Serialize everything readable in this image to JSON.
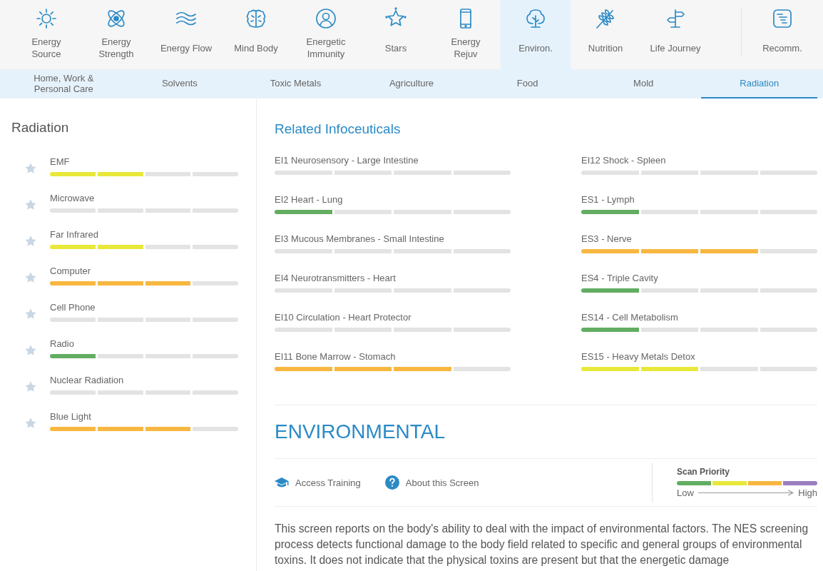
{
  "nav": [
    {
      "label": "Energy Source",
      "kind": "sun",
      "selected": false
    },
    {
      "label": "Energy Strength",
      "kind": "atom",
      "selected": false
    },
    {
      "label": "Energy Flow",
      "kind": "waves",
      "selected": false
    },
    {
      "label": "Mind Body",
      "kind": "brain",
      "selected": false
    },
    {
      "label": "Energetic Immunity",
      "kind": "person",
      "selected": false
    },
    {
      "label": "Stars",
      "kind": "star",
      "selected": false
    },
    {
      "label": "Energy Rejuv",
      "kind": "phone",
      "selected": false
    },
    {
      "label": "Environ.",
      "kind": "tree",
      "selected": true
    },
    {
      "label": "Nutrition",
      "kind": "wheat",
      "selected": false
    },
    {
      "label": "Life Journey",
      "kind": "signpost",
      "selected": false
    },
    {
      "label": "Recomm.",
      "kind": "list",
      "selected": false
    }
  ],
  "subtabs": [
    {
      "label": "Home, Work & Personal Care",
      "selected": false
    },
    {
      "label": "Solvents",
      "selected": false
    },
    {
      "label": "Toxic Metals",
      "selected": false
    },
    {
      "label": "Agriculture",
      "selected": false
    },
    {
      "label": "Food",
      "selected": false
    },
    {
      "label": "Mold",
      "selected": false
    },
    {
      "label": "Radiation",
      "selected": true
    }
  ],
  "factors": {
    "title": "Radiation",
    "items": [
      {
        "name": "EMF",
        "color": "#e8e83a",
        "segments": [
          {
            "filled": true
          },
          {
            "filled": true
          },
          {
            "filled": false
          },
          {
            "filled": false
          }
        ]
      },
      {
        "name": "Microwave",
        "segments": [
          {
            "filled": false
          },
          {
            "filled": false
          },
          {
            "filled": false
          },
          {
            "filled": false
          }
        ]
      },
      {
        "name": "Far Infrared",
        "color": "#e8e83a",
        "segments": [
          {
            "filled": true
          },
          {
            "filled": true
          },
          {
            "filled": false
          },
          {
            "filled": false
          }
        ]
      },
      {
        "name": "Computer",
        "color": "#f7b740",
        "segments": [
          {
            "filled": true
          },
          {
            "filled": true
          },
          {
            "filled": true
          },
          {
            "filled": false
          }
        ]
      },
      {
        "name": "Cell Phone",
        "segments": [
          {
            "filled": false
          },
          {
            "filled": false
          },
          {
            "filled": false
          },
          {
            "filled": false
          }
        ]
      },
      {
        "name": "Radio",
        "color": "#62ad62",
        "segments": [
          {
            "filled": true
          },
          {
            "filled": false
          },
          {
            "filled": false
          },
          {
            "filled": false
          }
        ]
      },
      {
        "name": "Nuclear Radiation",
        "segments": [
          {
            "filled": false
          },
          {
            "filled": false
          },
          {
            "filled": false
          },
          {
            "filled": false
          }
        ]
      },
      {
        "name": "Blue Light",
        "color": "#f7b740",
        "segments": [
          {
            "filled": true
          },
          {
            "filled": true
          },
          {
            "filled": true
          },
          {
            "filled": false
          }
        ]
      }
    ]
  },
  "infoceuticals": {
    "title": "Related Infoceuticals",
    "items": [
      {
        "name": "EI1 Neurosensory - Large Intestine",
        "segments": [
          {
            "filled": false
          },
          {
            "filled": false
          },
          {
            "filled": false
          },
          {
            "filled": false
          }
        ]
      },
      {
        "name": "EI12 Shock - Spleen",
        "segments": [
          {
            "filled": false
          },
          {
            "filled": false
          },
          {
            "filled": false
          },
          {
            "filled": false
          }
        ]
      },
      {
        "name": "EI2 Heart - Lung",
        "color": "#62ad62",
        "segments": [
          {
            "filled": true
          },
          {
            "filled": false
          },
          {
            "filled": false
          },
          {
            "filled": false
          }
        ]
      },
      {
        "name": "ES1 - Lymph",
        "color": "#62ad62",
        "segments": [
          {
            "filled": true
          },
          {
            "filled": false
          },
          {
            "filled": false
          },
          {
            "filled": false
          }
        ]
      },
      {
        "name": "EI3 Mucous Membranes - Small Intestine",
        "segments": [
          {
            "filled": false
          },
          {
            "filled": false
          },
          {
            "filled": false
          },
          {
            "filled": false
          }
        ]
      },
      {
        "name": "ES3 - Nerve",
        "color": "#f7b740",
        "segments": [
          {
            "filled": true
          },
          {
            "filled": true
          },
          {
            "filled": true
          },
          {
            "filled": false
          }
        ]
      },
      {
        "name": "EI4 Neurotransmitters - Heart",
        "segments": [
          {
            "filled": false
          },
          {
            "filled": false
          },
          {
            "filled": false
          },
          {
            "filled": false
          }
        ]
      },
      {
        "name": "ES4 - Triple Cavity",
        "color": "#62ad62",
        "segments": [
          {
            "filled": true
          },
          {
            "filled": false
          },
          {
            "filled": false
          },
          {
            "filled": false
          }
        ]
      },
      {
        "name": "EI10 Circulation - Heart Protector",
        "segments": [
          {
            "filled": false
          },
          {
            "filled": false
          },
          {
            "filled": false
          },
          {
            "filled": false
          }
        ]
      },
      {
        "name": "ES14 - Cell Metabolism",
        "color": "#62ad62",
        "segments": [
          {
            "filled": true
          },
          {
            "filled": false
          },
          {
            "filled": false
          },
          {
            "filled": false
          }
        ]
      },
      {
        "name": "EI11 Bone Marrow - Stomach",
        "color": "#f7b740",
        "segments": [
          {
            "filled": true
          },
          {
            "filled": true
          },
          {
            "filled": true
          },
          {
            "filled": false
          }
        ]
      },
      {
        "name": "ES15 - Heavy Metals Detox",
        "color": "#e8e83a",
        "segments": [
          {
            "filled": true
          },
          {
            "filled": true
          },
          {
            "filled": false
          },
          {
            "filled": false
          }
        ]
      }
    ]
  },
  "section": {
    "title": "ENVIRONMENTAL",
    "links": [
      {
        "label": "Access Training",
        "kind": "training"
      },
      {
        "label": "About this Screen",
        "kind": "help"
      }
    ],
    "scan_priority": {
      "title": "Scan Priority",
      "low": "Low",
      "high": "High",
      "segments": [
        {
          "color": "#62ad62"
        },
        {
          "color": "#e8e83a"
        },
        {
          "color": "#f7b740"
        },
        {
          "color": "#9b7fc0"
        }
      ]
    },
    "description": "This screen reports on the body's ability to deal with the impact of environmental factors. The NES screening process detects functional damage to the body field related to specific and general groups of environmental toxins. It does not indicate that the physical toxins are present but that the energetic damage"
  }
}
